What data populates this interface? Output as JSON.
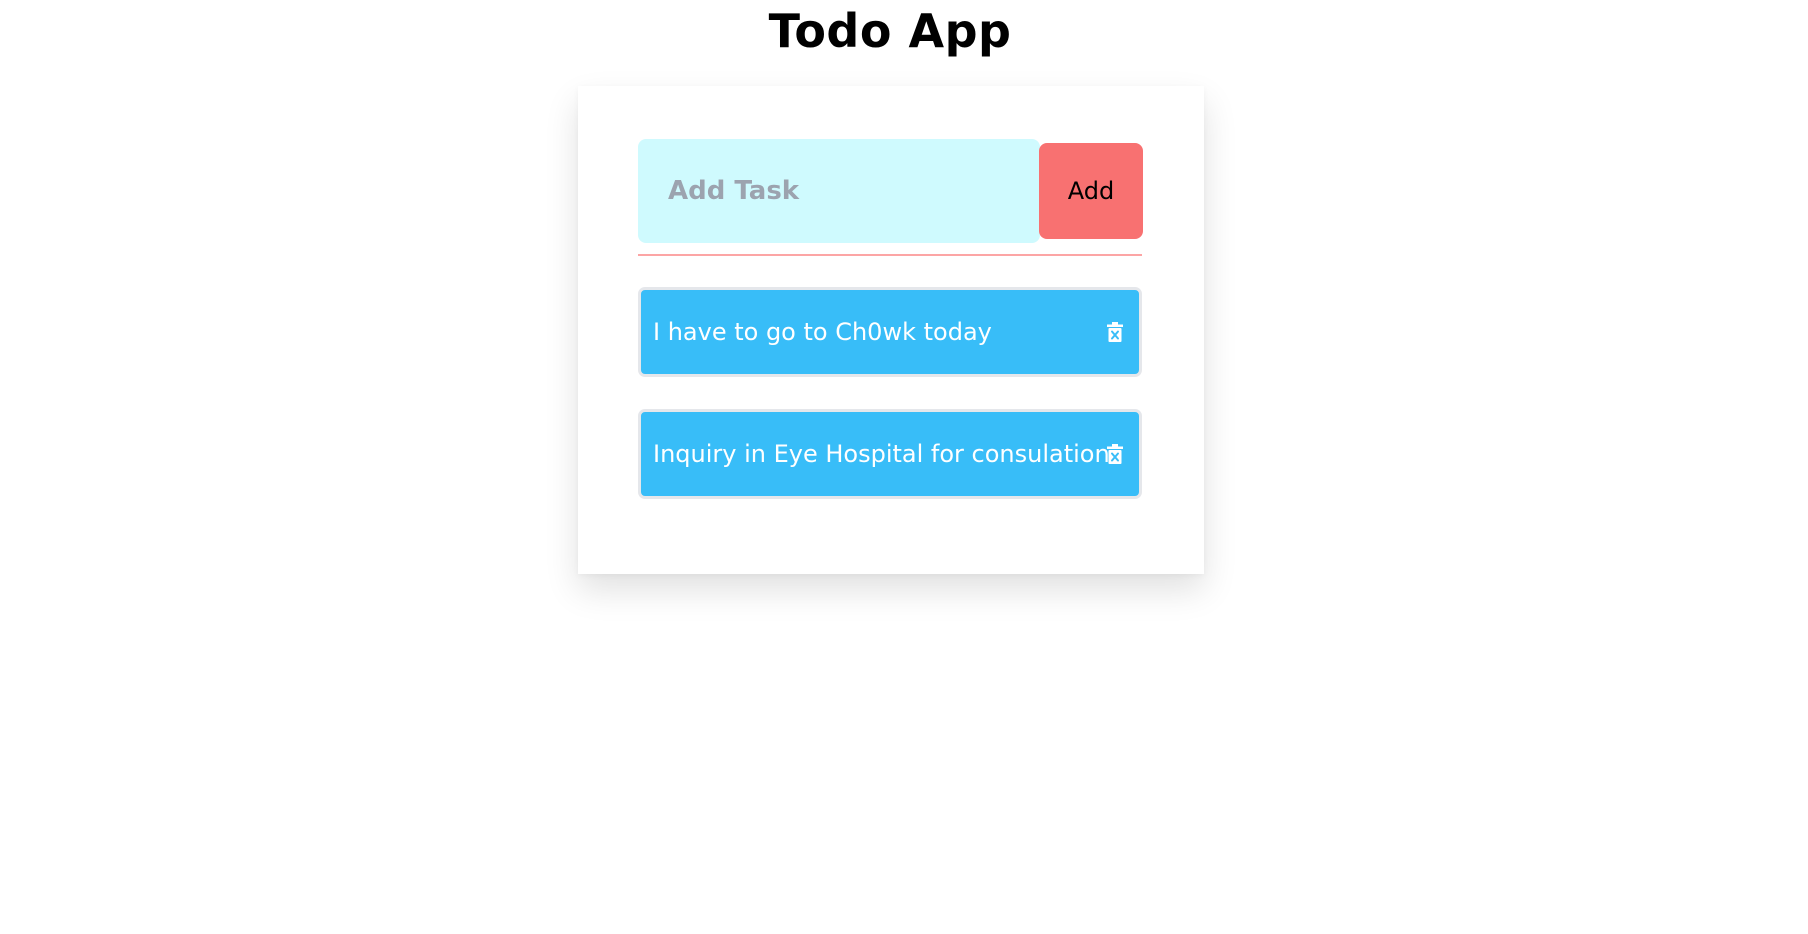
{
  "app": {
    "title": "Todo App"
  },
  "input": {
    "placeholder": "Add Task",
    "value": ""
  },
  "add_button": {
    "label": "Add"
  },
  "tasks": [
    {
      "text": "I have to go to Ch0wk today",
      "icon": "trash-icon"
    },
    {
      "text": "Inquiry in Eye Hospital for consulation",
      "icon": "trash-icon"
    }
  ],
  "colors": {
    "input_bg": "#cffafe",
    "add_button_bg": "#f87171",
    "divider": "#fca5a5",
    "task_bg": "#38bdf8",
    "task_border": "#e5e7eb"
  }
}
